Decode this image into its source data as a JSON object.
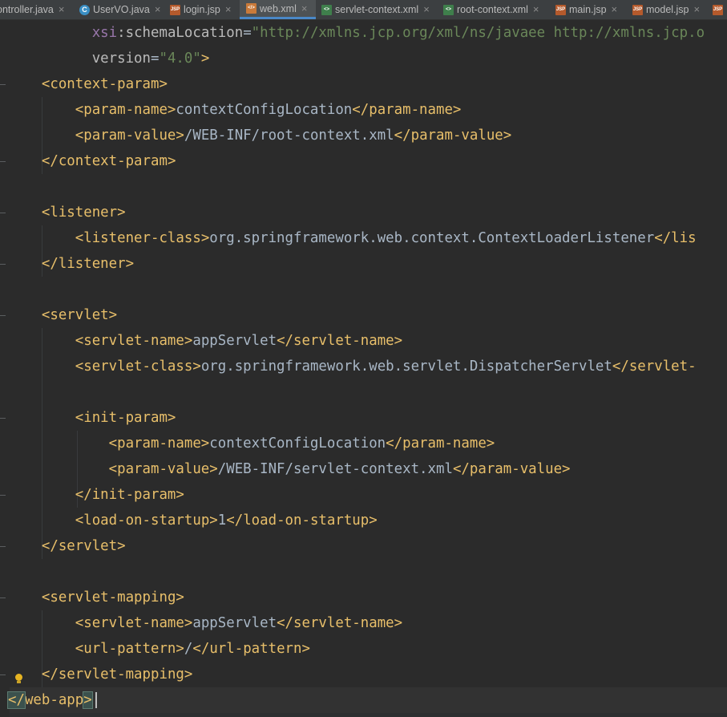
{
  "tabs": [
    {
      "label": "ontroller.java",
      "icon": "java-class-icon",
      "active": false
    },
    {
      "label": "UserVO.java",
      "icon": "java-class-icon",
      "active": false
    },
    {
      "label": "login.jsp",
      "icon": "jsp-file-icon",
      "active": false
    },
    {
      "label": "web.xml",
      "icon": "xml-file-icon",
      "active": true
    },
    {
      "label": "servlet-context.xml",
      "icon": "spring-xml-file-icon",
      "active": false
    },
    {
      "label": "root-context.xml",
      "icon": "spring-xml-file-icon",
      "active": false
    },
    {
      "label": "main.jsp",
      "icon": "jsp-file-icon",
      "active": false
    },
    {
      "label": "model.jsp",
      "icon": "jsp-file-icon",
      "active": false
    }
  ],
  "close_glyph": "×",
  "code": {
    "l1_ns": "xsi",
    "l1_attr": ":schemaLocation",
    "l1_eq": "=",
    "l1_val": "\"http://xmlns.jcp.org/xml/ns/javaee http://xmlns.jcp.o",
    "l2_attr": "version",
    "l2_eq": "=",
    "l2_val": "\"4.0\"",
    "l2_close": ">",
    "context_param_open": "<context-param>",
    "param_name_open": "<param-name>",
    "param_name_close": "</param-name>",
    "param_value_open": "<param-value>",
    "param_value_close": "</param-value>",
    "context_config_location": "contextConfigLocation",
    "root_context_path": "/WEB-INF/root-context.xml",
    "context_param_close": "</context-param>",
    "listener_open": "<listener>",
    "listener_class_open": "<listener-class>",
    "listener_class_value": "org.springframework.web.context.ContextLoaderListener",
    "listener_class_close_cut": "</lis",
    "listener_close": "</listener>",
    "servlet_open": "<servlet>",
    "servlet_name_open": "<servlet-name>",
    "servlet_name_value": "appServlet",
    "servlet_name_close": "</servlet-name>",
    "servlet_class_open": "<servlet-class>",
    "servlet_class_value": "org.springframework.web.servlet.DispatcherServlet",
    "servlet_class_close_cut": "</servlet-",
    "init_param_open": "<init-param>",
    "servlet_context_path": "/WEB-INF/servlet-context.xml",
    "init_param_close": "</init-param>",
    "load_on_startup_open": "<load-on-startup>",
    "load_on_startup_value": "1",
    "load_on_startup_close": "</load-on-startup>",
    "servlet_close": "</servlet>",
    "servlet_mapping_open": "<servlet-mapping>",
    "url_pattern_open": "<url-pattern>",
    "url_pattern_value": "/",
    "url_pattern_close": "</url-pattern>",
    "servlet_mapping_close": "</servlet-mapping>",
    "web_app_close_lt": "</",
    "web_app_close_name": "web-app",
    "web_app_close_gt": ">"
  },
  "colors": {
    "background": "#2b2b2b",
    "tag": "#e8bf6a",
    "text": "#a9b7c6",
    "attribute": "#bababa",
    "namespace": "#9876aa",
    "string": "#6a8759",
    "active_tab_underline": "#4a88c7"
  }
}
